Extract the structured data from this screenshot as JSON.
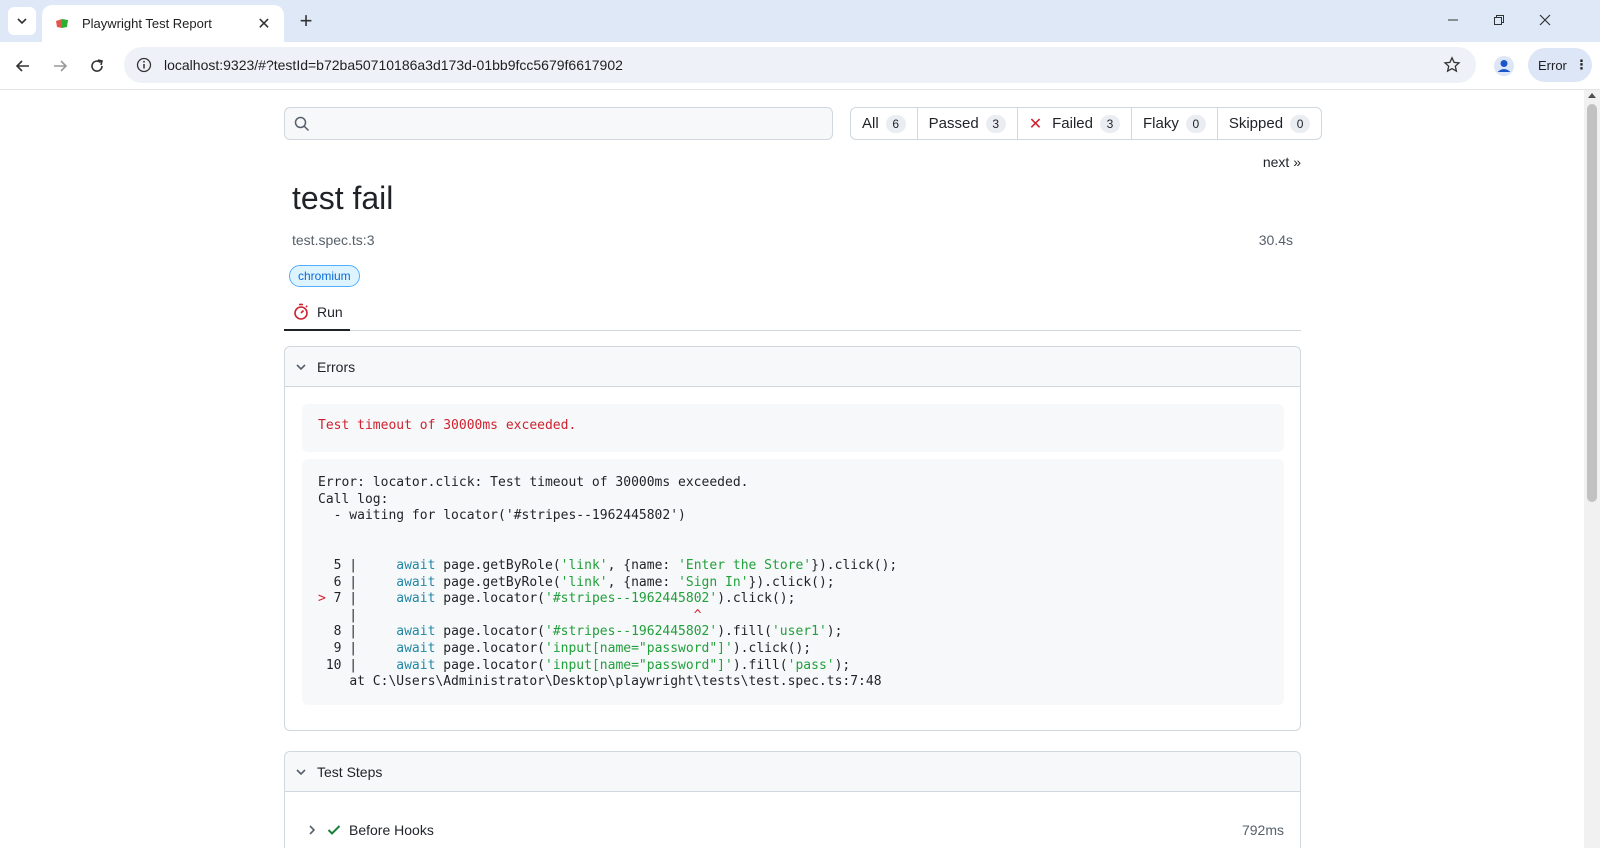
{
  "browser": {
    "tab_title": "Playwright Test Report",
    "url": "localhost:9323/#?testId=b72ba50710186a3d173d-01bb9fcc5679f6617902",
    "profile_chip": "Error"
  },
  "report": {
    "search_placeholder": "",
    "filters": [
      {
        "label": "All",
        "count": "6"
      },
      {
        "label": "Passed",
        "count": "3"
      },
      {
        "label": "Failed",
        "count": "3"
      },
      {
        "label": "Flaky",
        "count": "0"
      },
      {
        "label": "Skipped",
        "count": "0"
      }
    ],
    "next_link": "next »",
    "test_title": "test fail",
    "location": "test.spec.ts:3",
    "duration": "30.4s",
    "project_tag": "chromium",
    "tab_run": "Run",
    "errors_header": "Errors",
    "error_short": "Test timeout of 30000ms exceeded.",
    "error_detail": {
      "line1": "Error: locator.click: Test timeout of 30000ms exceeded.",
      "line2": "Call log:",
      "line3": "  - waiting for locator('#stripes--1962445802')",
      "code": [
        {
          "num": "5",
          "marker": " ",
          "text": "await page.getByRole('link', {name: 'Enter the Store'}).click();"
        },
        {
          "num": "6",
          "marker": " ",
          "text": "await page.getByRole('link', {name: 'Sign In'}).click();"
        },
        {
          "num": "7",
          "marker": ">",
          "text": "await page.locator('#stripes--1962445802').click();"
        },
        {
          "num": "8",
          "marker": " ",
          "text": "await page.locator('#stripes--1962445802').fill('user1');"
        },
        {
          "num": "9",
          "marker": " ",
          "text": "await page.locator('input[name=\"password\"]').click();"
        },
        {
          "num": "10",
          "marker": " ",
          "text": "await page.locator('input[name=\"password\"]').fill('pass');"
        }
      ],
      "at_line": "at C:\\Users\\Administrator\\Desktop\\playwright\\tests\\test.spec.ts:7:48"
    },
    "steps_header": "Test Steps",
    "steps": [
      {
        "label": "Before Hooks",
        "duration": "792ms"
      }
    ]
  },
  "colors": {
    "failed": "#cf222e",
    "passed": "#1a7f37",
    "tag_blue": "#0969da"
  }
}
